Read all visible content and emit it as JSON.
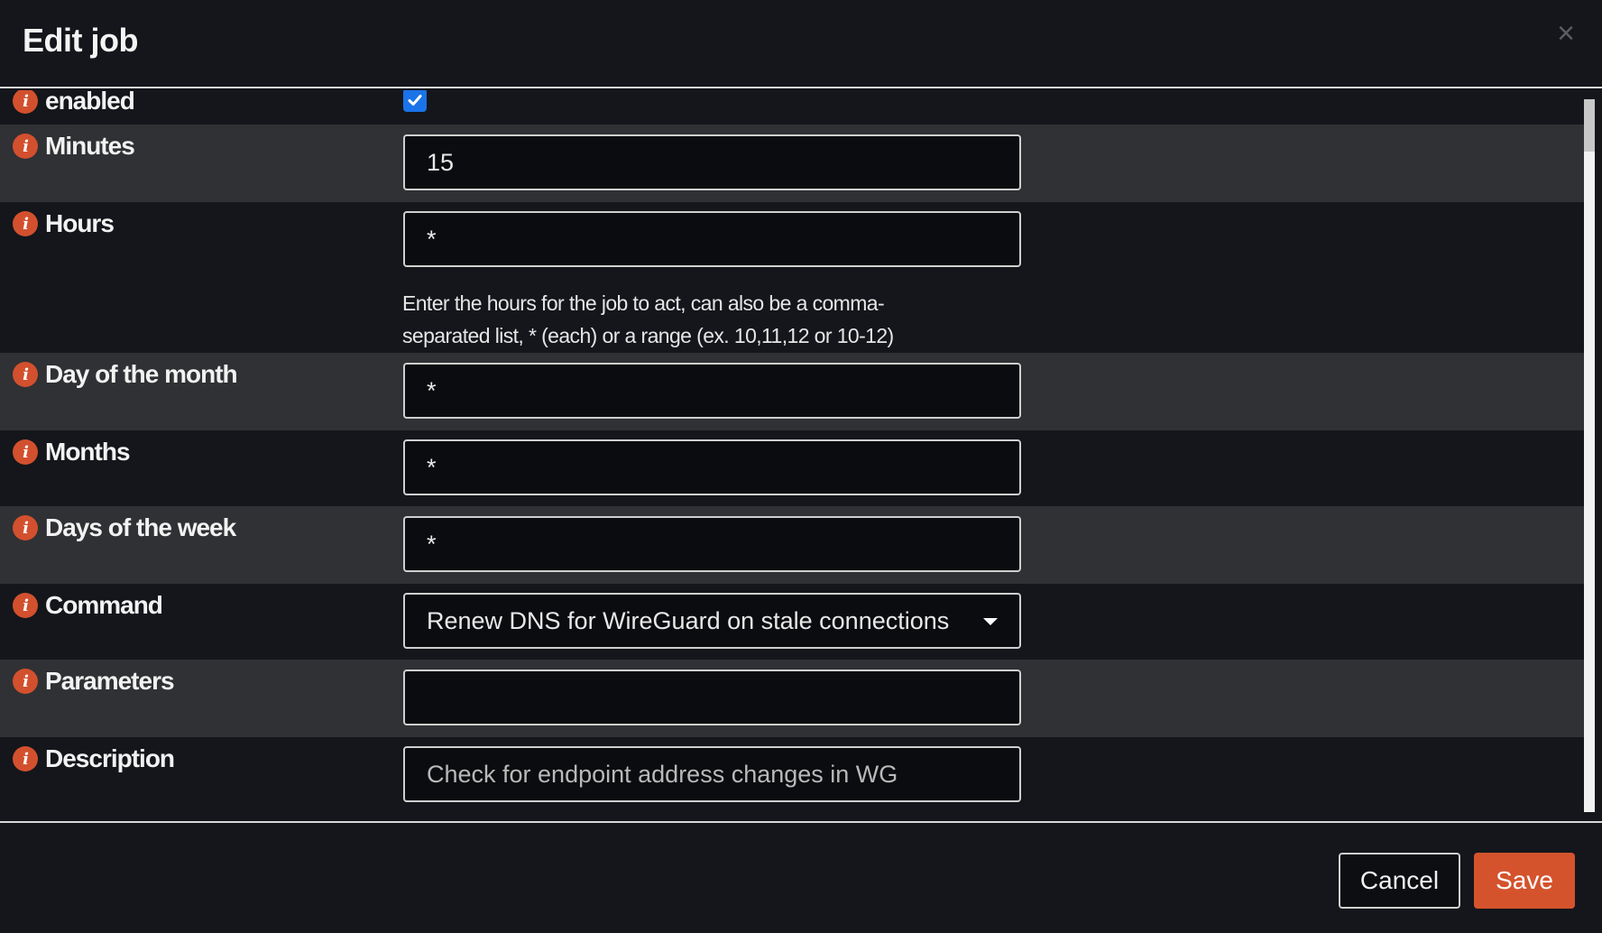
{
  "dialog": {
    "title": "Edit job",
    "close_glyph": "×"
  },
  "fields": {
    "enabled": {
      "label": "enabled",
      "checked": true
    },
    "minutes": {
      "label": "Minutes",
      "value": "15"
    },
    "hours": {
      "label": "Hours",
      "value": "*",
      "help": "Enter the hours for the job to act, can also be a comma-separated list, * (each) or a range (ex. 10,11,12 or 10-12)"
    },
    "day_of_month": {
      "label": "Day of the month",
      "value": "*"
    },
    "months": {
      "label": "Months",
      "value": "*"
    },
    "days_of_week": {
      "label": "Days of the week",
      "value": "*"
    },
    "command": {
      "label": "Command",
      "value": "Renew DNS for WireGuard on stale connections"
    },
    "parameters": {
      "label": "Parameters",
      "value": ""
    },
    "description": {
      "label": "Description",
      "placeholder": "Check for endpoint address changes in WG"
    }
  },
  "icons": {
    "info": "info-icon",
    "info_glyph": "i"
  },
  "footer": {
    "cancel_label": "Cancel",
    "save_label": "Save"
  },
  "colors": {
    "accent": "#d4532d",
    "checkbox": "#1a73e8",
    "background": "#14161b",
    "row_alt": "#303134"
  }
}
